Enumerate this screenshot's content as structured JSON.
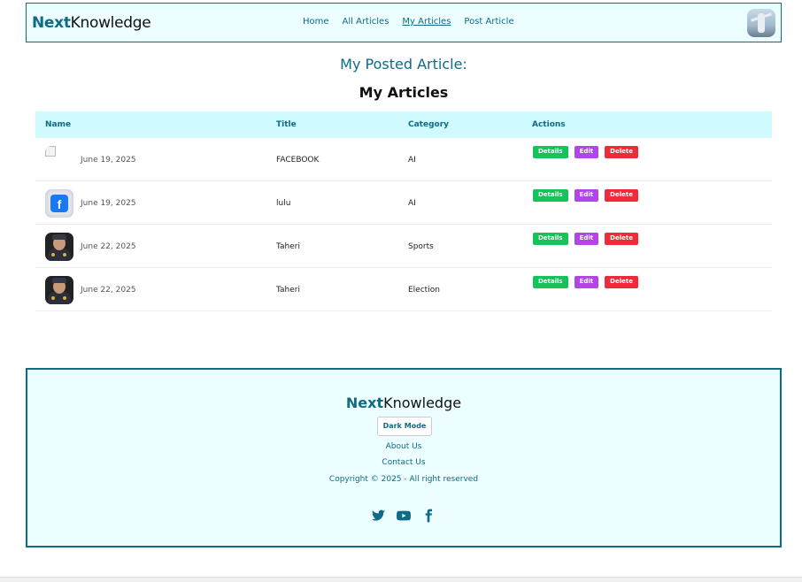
{
  "navbar": {
    "brand_bold": "Next",
    "brand_rest": "Knowledge",
    "links": [
      {
        "label": "Home",
        "active": false
      },
      {
        "label": "All Articles",
        "active": false
      },
      {
        "label": "My Articles",
        "active": true
      },
      {
        "label": "Post Article",
        "active": false
      }
    ]
  },
  "page_heading": "My Posted Article:",
  "section_title": "My Articles",
  "table": {
    "headers": {
      "name": "Name",
      "title": "Title",
      "category": "Category",
      "actions": "Actions"
    },
    "rows": [
      {
        "date": "June 19, 2025",
        "title": "FACEBOOK",
        "category": "AI",
        "image": "broken-image"
      },
      {
        "date": "June 19, 2025",
        "title": "lulu",
        "category": "AI",
        "image": "facebook-logo"
      },
      {
        "date": "June 22, 2025",
        "title": "Taheri",
        "category": "Sports",
        "image": "person-photo"
      },
      {
        "date": "June 22, 2025",
        "title": "Taheri",
        "category": "Election",
        "image": "person-photo"
      }
    ],
    "action_labels": {
      "details": "Details",
      "edit": "Edit",
      "delete": "Delete"
    }
  },
  "footer": {
    "brand_bold": "Next",
    "brand_rest": "Knowledge",
    "dark_mode_label": "Dark Mode",
    "about_label": "About Us",
    "contact_label": "Contact Us",
    "copyright": "Copyright © 2025 - All right reserved",
    "social_icons": [
      "twitter-icon",
      "youtube-icon",
      "facebook-icon"
    ]
  },
  "colors": {
    "accent": "#0e6b86",
    "nav_bg": "#ecfeff",
    "table_header_bg": "#cffafe",
    "details": "#16c25a",
    "edit": "#b145e9",
    "delete": "#ef2b3a"
  }
}
